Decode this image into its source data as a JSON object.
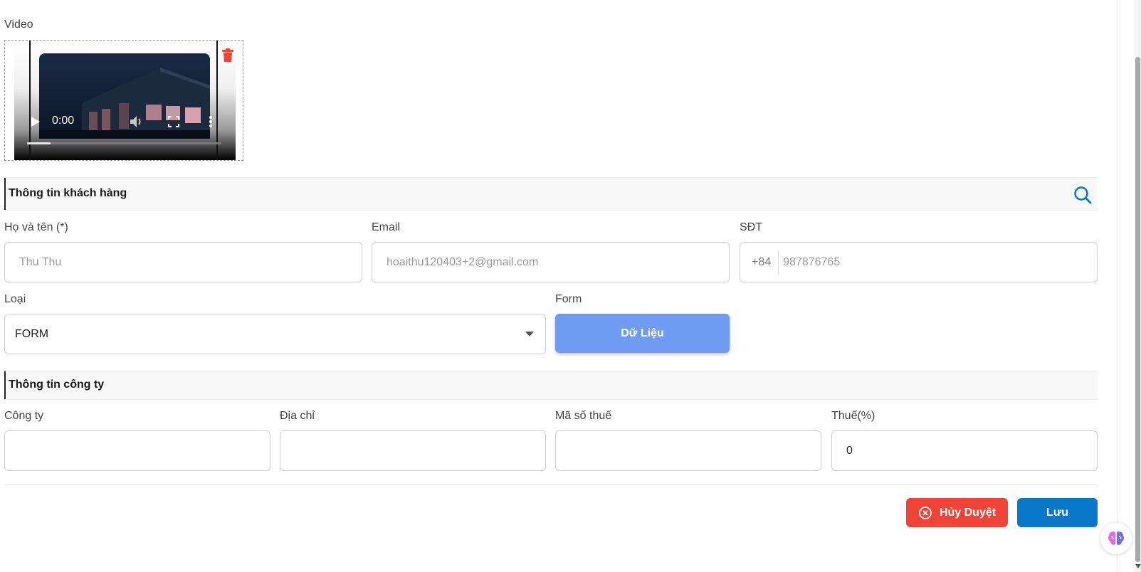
{
  "video": {
    "label": "Video",
    "time": "0:00",
    "progress": 0.12
  },
  "customer": {
    "section_title": "Thông tin khách hàng",
    "name_label": "Họ và tên (*)",
    "name_placeholder": "Thu Thu",
    "email_label": "Email",
    "email_placeholder": "hoaithu120403+2@gmail.com",
    "phone_label": "SĐT",
    "phone_prefix": "+84",
    "phone_placeholder": "987876765",
    "type_label": "Loại",
    "type_value": "FORM",
    "form_label": "Form",
    "form_button": "Dữ Liệu"
  },
  "company": {
    "section_title": "Thông tin công ty",
    "company_label": "Công ty",
    "company_value": "",
    "address_label": "Địa chỉ",
    "address_value": "",
    "tax_code_label": "Mã số thuế",
    "tax_code_value": "",
    "tax_rate_label": "Thuế(%)",
    "tax_rate_value": "0"
  },
  "actions": {
    "cancel_label": "Hủy Duyệt",
    "save_label": "Lưu"
  },
  "colors": {
    "accent": "#0a78c8",
    "danger": "#f04438",
    "form_button": "#6f9bf2"
  },
  "icons": [
    "trash-icon",
    "search-icon",
    "play-icon",
    "volume-icon",
    "fullscreen-icon",
    "more-icon",
    "cancel-circle-icon",
    "brain-icon"
  ]
}
